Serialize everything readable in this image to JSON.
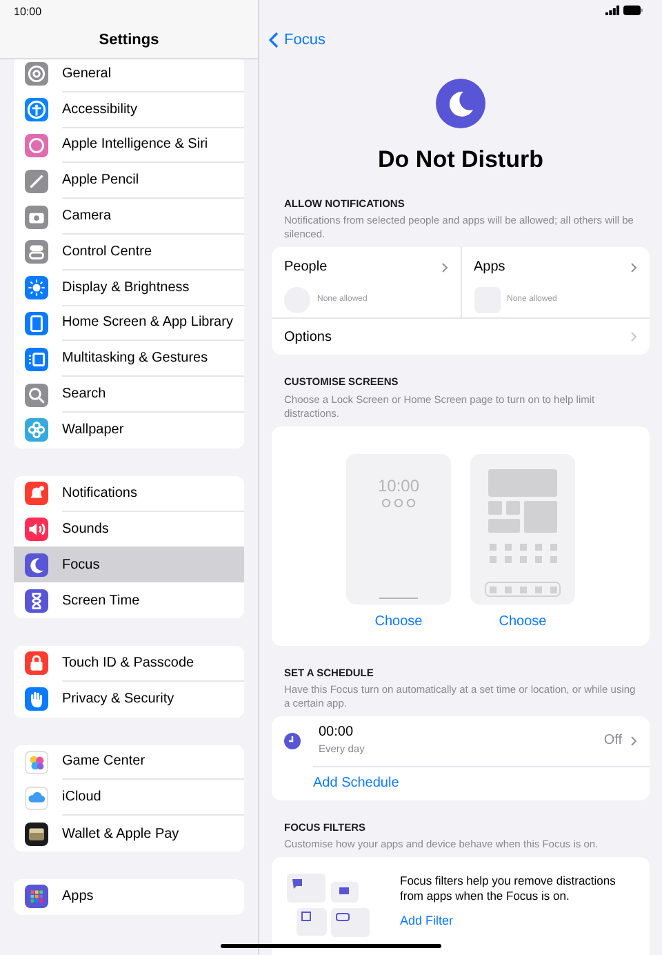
{
  "status_bar": {
    "time": "10:00"
  },
  "sidebar": {
    "title": "Settings",
    "groups": [
      [
        {
          "label": "General",
          "color": "#8e8e93",
          "selected": false
        },
        {
          "label": "Accessibility",
          "color": "#0a84ff",
          "selected": false
        },
        {
          "label": "Apple Intelligence & Siri",
          "color": "#e06bb0",
          "selected": false
        },
        {
          "label": "Apple Pencil",
          "color": "#8e8e93",
          "selected": false
        },
        {
          "label": "Camera",
          "color": "#8e8e93",
          "selected": false
        },
        {
          "label": "Control Centre",
          "color": "#8e8e93",
          "selected": false
        },
        {
          "label": "Display & Brightness",
          "color": "#0a7aff",
          "selected": false
        },
        {
          "label": "Home Screen & App Library",
          "color": "#0a7aff",
          "selected": false
        },
        {
          "label": "Multitasking & Gestures",
          "color": "#0a7aff",
          "selected": false
        },
        {
          "label": "Search",
          "color": "#8e8e93",
          "selected": false
        },
        {
          "label": "Wallpaper",
          "color": "#35aadc",
          "selected": false
        }
      ],
      [
        {
          "label": "Notifications",
          "color": "#ff3b30",
          "selected": false
        },
        {
          "label": "Sounds",
          "color": "#ff2d55",
          "selected": false
        },
        {
          "label": "Focus",
          "color": "#5856d6",
          "selected": true
        },
        {
          "label": "Screen Time",
          "color": "#5856d6",
          "selected": false
        }
      ],
      [
        {
          "label": "Touch ID & Passcode",
          "color": "#ff3b30",
          "selected": false
        },
        {
          "label": "Privacy & Security",
          "color": "#0a7aff",
          "selected": false
        }
      ],
      [
        {
          "label": "Game Center",
          "color": "#ffffff",
          "selected": false
        },
        {
          "label": "iCloud",
          "color": "#ffffff",
          "selected": false
        },
        {
          "label": "Wallet & Apple Pay",
          "color": "#1c1c1e",
          "selected": false
        }
      ],
      [
        {
          "label": "Apps",
          "color": "#5856d6",
          "selected": false
        }
      ]
    ]
  },
  "detail": {
    "back": "Focus",
    "title": "Do Not Disturb",
    "allow_notifications": {
      "header": "ALLOW NOTIFICATIONS",
      "description": "Notifications from selected people and apps will be allowed; all others will be silenced.",
      "people": {
        "label": "People",
        "status": "None allowed"
      },
      "apps": {
        "label": "Apps",
        "status": "None allowed"
      },
      "options": "Options"
    },
    "customise_screens": {
      "header": "CUSTOMISE SCREENS",
      "description": "Choose a Lock Screen or Home Screen page to turn on to help limit distractions.",
      "lock_screen": {
        "time": "10:00",
        "action": "Choose"
      },
      "home_screen": {
        "action": "Choose"
      }
    },
    "schedule": {
      "header": "SET A SCHEDULE",
      "description": "Have this Focus turn on automatically at a set time or location, or while using a certain app.",
      "items": [
        {
          "time": "00:00",
          "repeat": "Every day",
          "state": "Off"
        }
      ],
      "add": "Add Schedule"
    },
    "focus_filters": {
      "header": "FOCUS FILTERS",
      "description": "Customise how your apps and device behave when this Focus is on.",
      "text": "Focus filters help you remove distractions from apps when the Focus is on.",
      "add": "Add Filter"
    }
  }
}
